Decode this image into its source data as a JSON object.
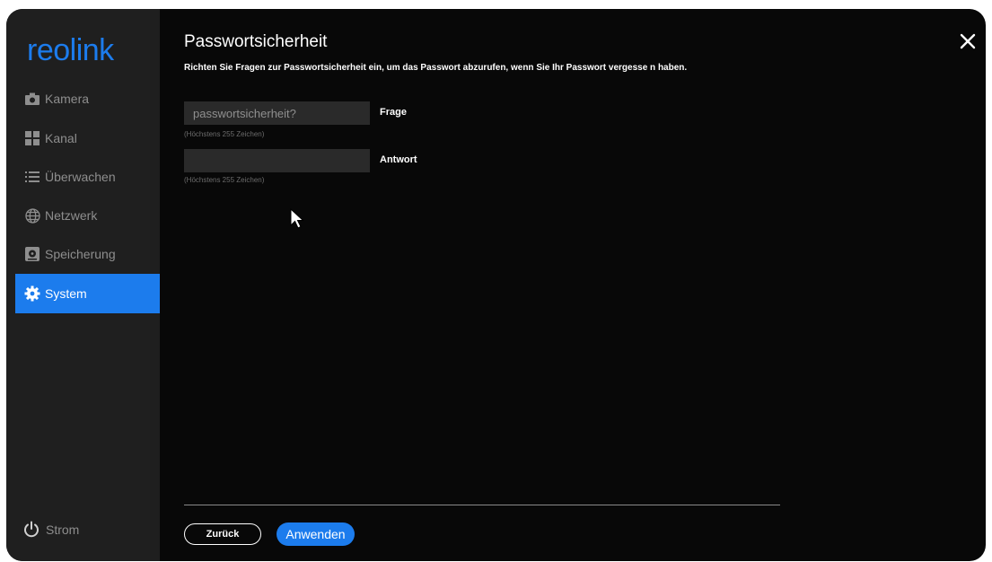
{
  "brand": {
    "logo_text": "reolink",
    "logo_color": "#1c7ced"
  },
  "sidebar": {
    "items": [
      {
        "label": "Kamera",
        "icon": "camera-icon",
        "active": false
      },
      {
        "label": "Kanal",
        "icon": "channel-grid-icon",
        "active": false
      },
      {
        "label": "Überwachen",
        "icon": "list-icon",
        "active": false
      },
      {
        "label": "Netzwerk",
        "icon": "globe-icon",
        "active": false
      },
      {
        "label": "Speicherung",
        "icon": "storage-icon",
        "active": false
      },
      {
        "label": "System",
        "icon": "gear-icon",
        "active": true
      }
    ],
    "power_label": "Strom"
  },
  "page": {
    "title": "Passwortsicherheit",
    "description": "Richten Sie Fragen zur Passwortsicherheit ein, um das Passwort abzurufen, wenn Sie Ihr Passwort vergesse n haben."
  },
  "form": {
    "question": {
      "value": "passwortsicherheit?",
      "label": "Frage",
      "hint": "(Höchstens 255 Zeichen)"
    },
    "answer": {
      "value": "",
      "label": "Antwort",
      "hint": "(Höchstens 255 Zeichen)"
    }
  },
  "buttons": {
    "back": "Zurück",
    "apply": "Anwenden"
  },
  "colors": {
    "accent": "#1c7ced",
    "sidebar_bg": "#1f1f1f",
    "content_bg": "#080808"
  }
}
